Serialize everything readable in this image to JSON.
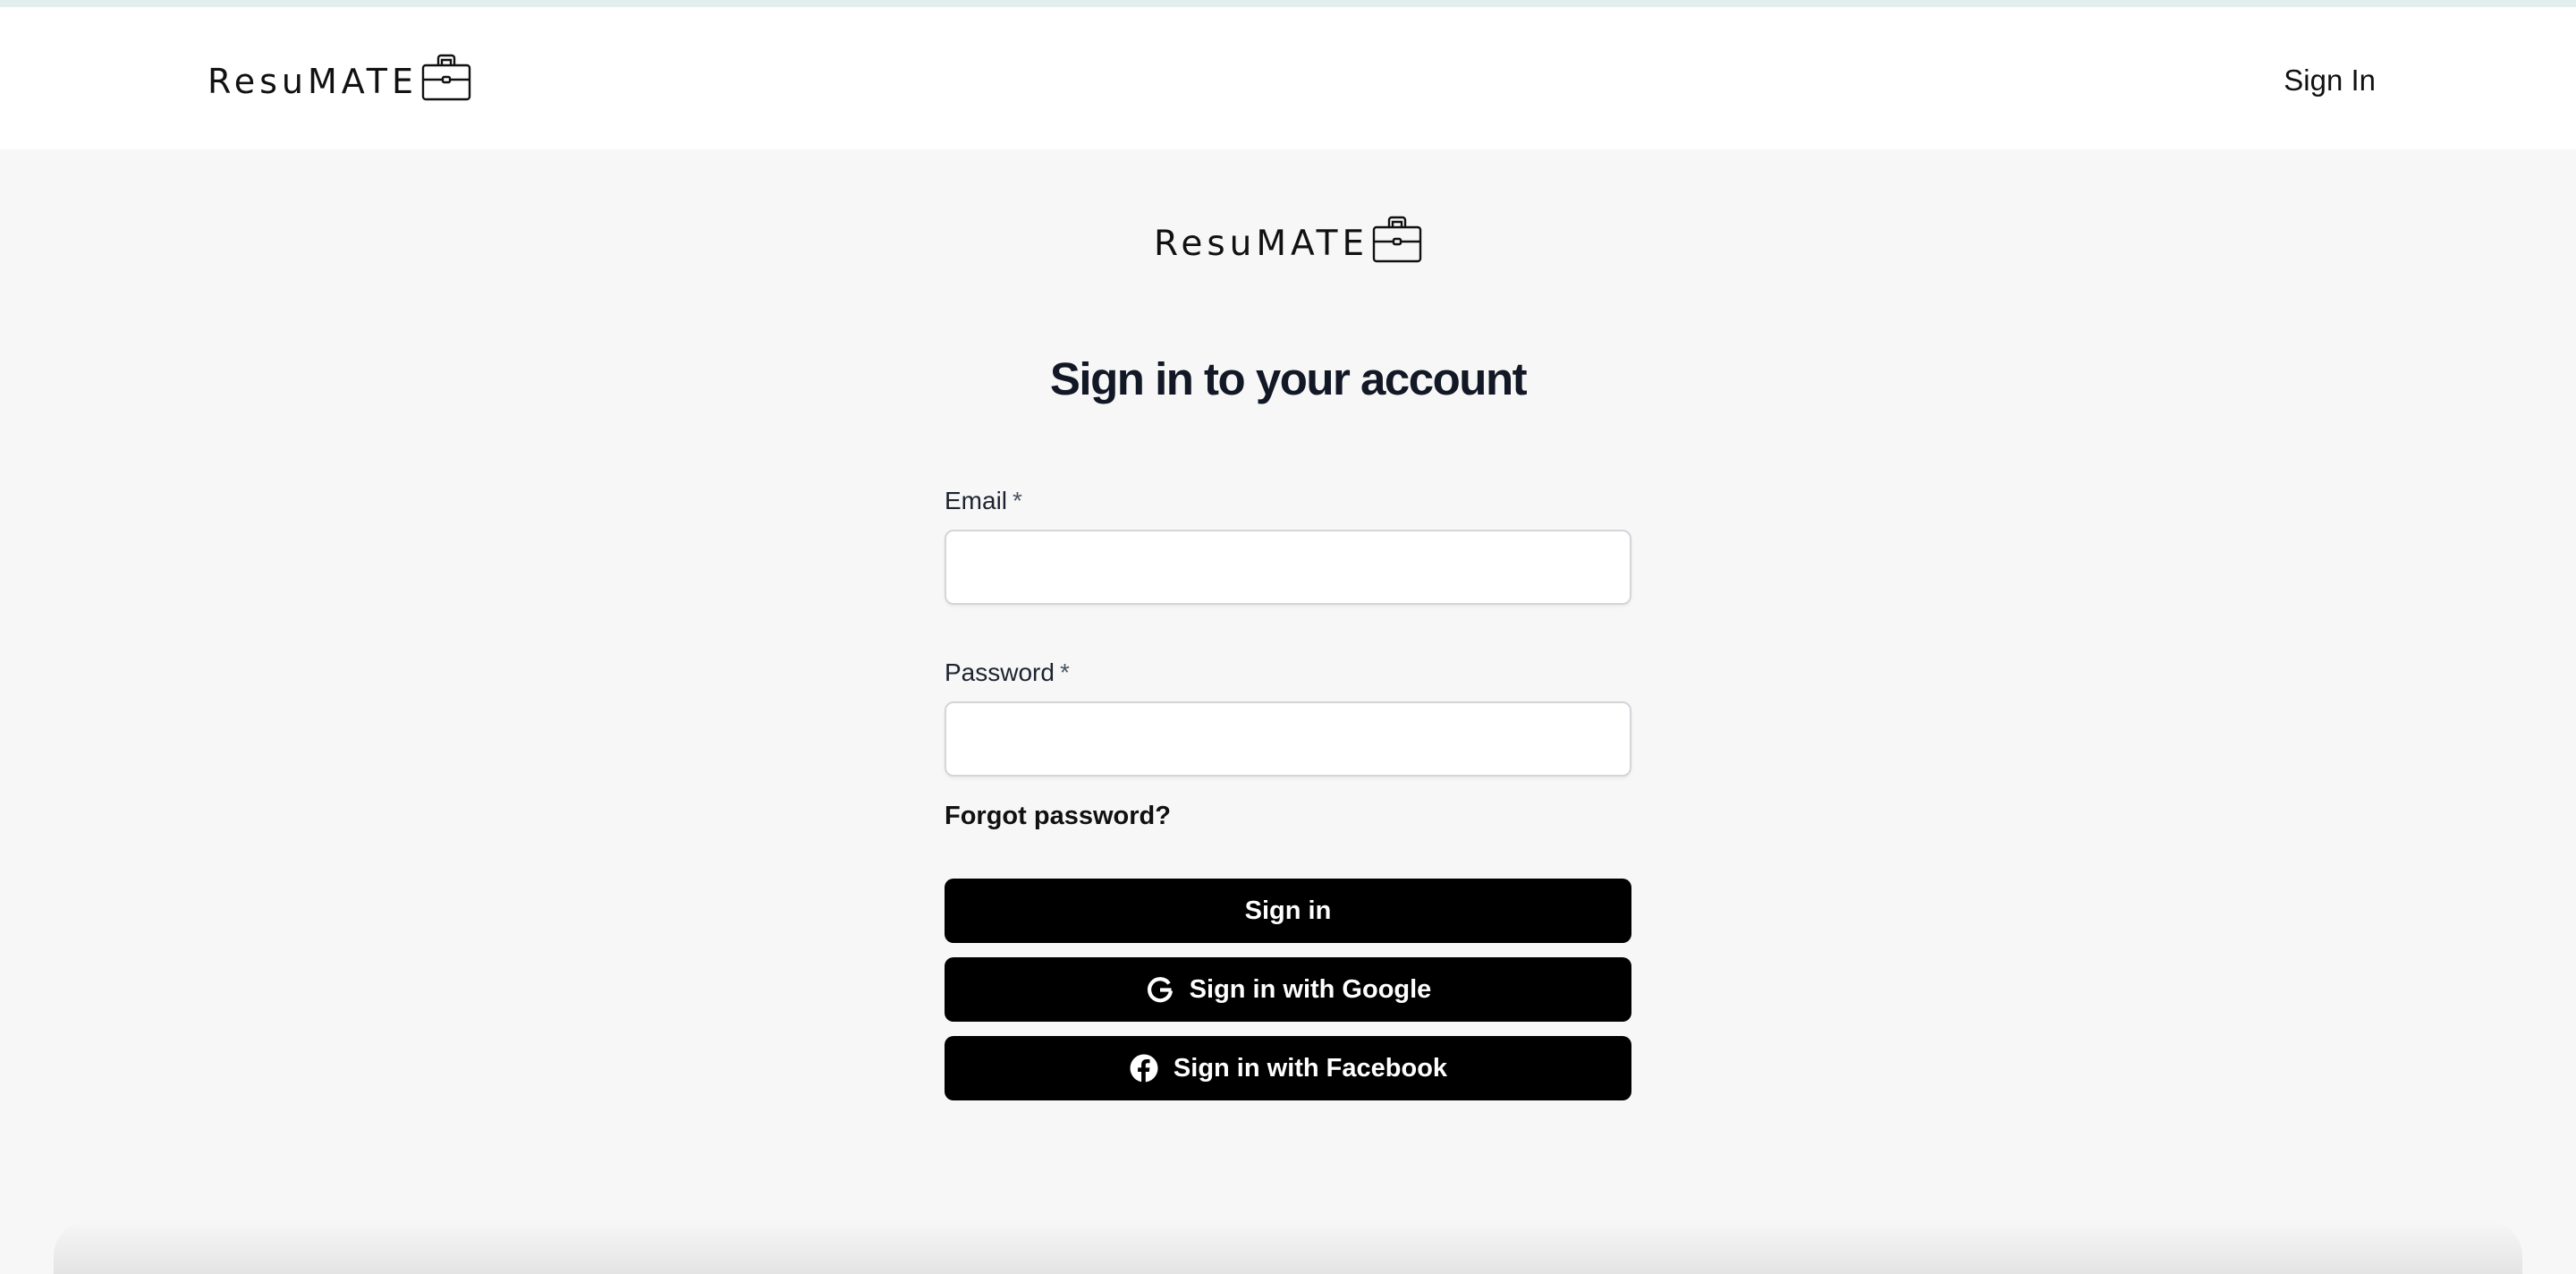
{
  "header": {
    "logo_text": "ResuMATE",
    "signin_link": "Sign In"
  },
  "main": {
    "logo_text": "ResuMATE",
    "title": "Sign in to your account"
  },
  "form": {
    "email_label": "Email",
    "email_required": "*",
    "email_value": "",
    "password_label": "Password",
    "password_required": "*",
    "password_value": "",
    "forgot_link": "Forgot password?",
    "signin_button": "Sign in",
    "google_button": "Sign in with Google",
    "facebook_button": "Sign in with Facebook"
  },
  "icons": {
    "logo": "briefcase-icon",
    "google": "google-icon",
    "facebook": "facebook-icon"
  },
  "colors": {
    "background": "#f7f7f7",
    "header_bg": "#ffffff",
    "button_bg": "#000000",
    "button_text": "#ffffff",
    "title_text": "#121826"
  }
}
